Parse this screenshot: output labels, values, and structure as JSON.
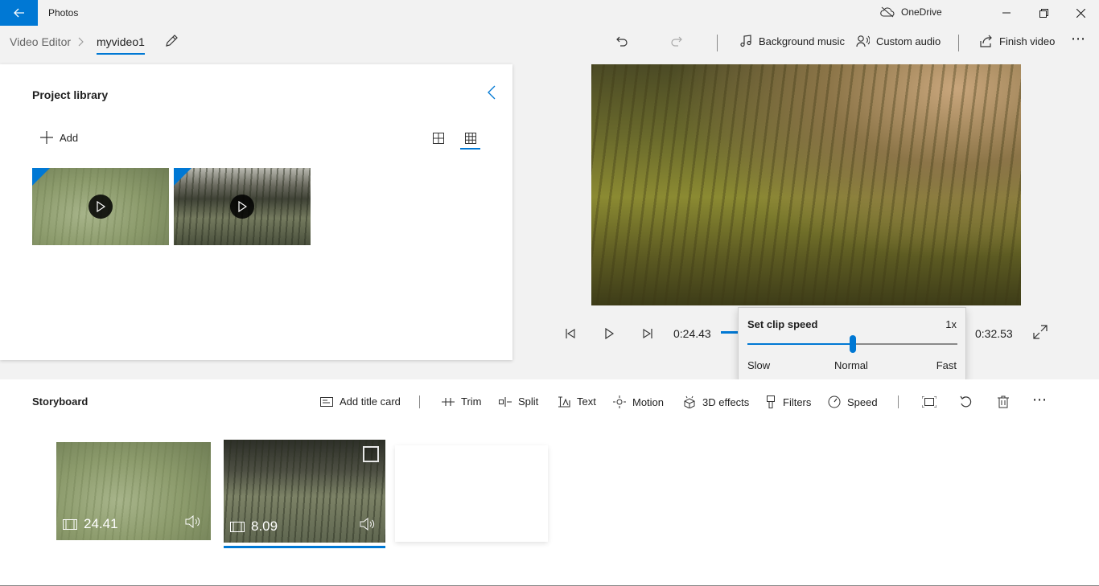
{
  "titlebar": {
    "app_title": "Photos",
    "onedrive_label": "OneDrive"
  },
  "breadcrumb": {
    "root": "Video Editor",
    "current": "myvideo1"
  },
  "toolbar": {
    "background_music": "Background music",
    "custom_audio": "Custom audio",
    "finish_video": "Finish video"
  },
  "library": {
    "title": "Project library",
    "add_label": "Add"
  },
  "playback": {
    "current_time": "0:24.43",
    "total_time": "0:32.53"
  },
  "speed_flyout": {
    "title": "Set clip speed",
    "value": "1x",
    "position": 0.5,
    "slow_label": "Slow",
    "normal_label": "Normal",
    "fast_label": "Fast"
  },
  "storyboard": {
    "title": "Storyboard",
    "add_title_card": "Add title card",
    "trim": "Trim",
    "split": "Split",
    "text": "Text",
    "motion": "Motion",
    "effects_3d": "3D effects",
    "filters": "Filters",
    "speed": "Speed",
    "clips": [
      {
        "duration": "24.41"
      },
      {
        "duration": "8.09"
      }
    ]
  },
  "colors": {
    "accent": "#0078d4"
  }
}
